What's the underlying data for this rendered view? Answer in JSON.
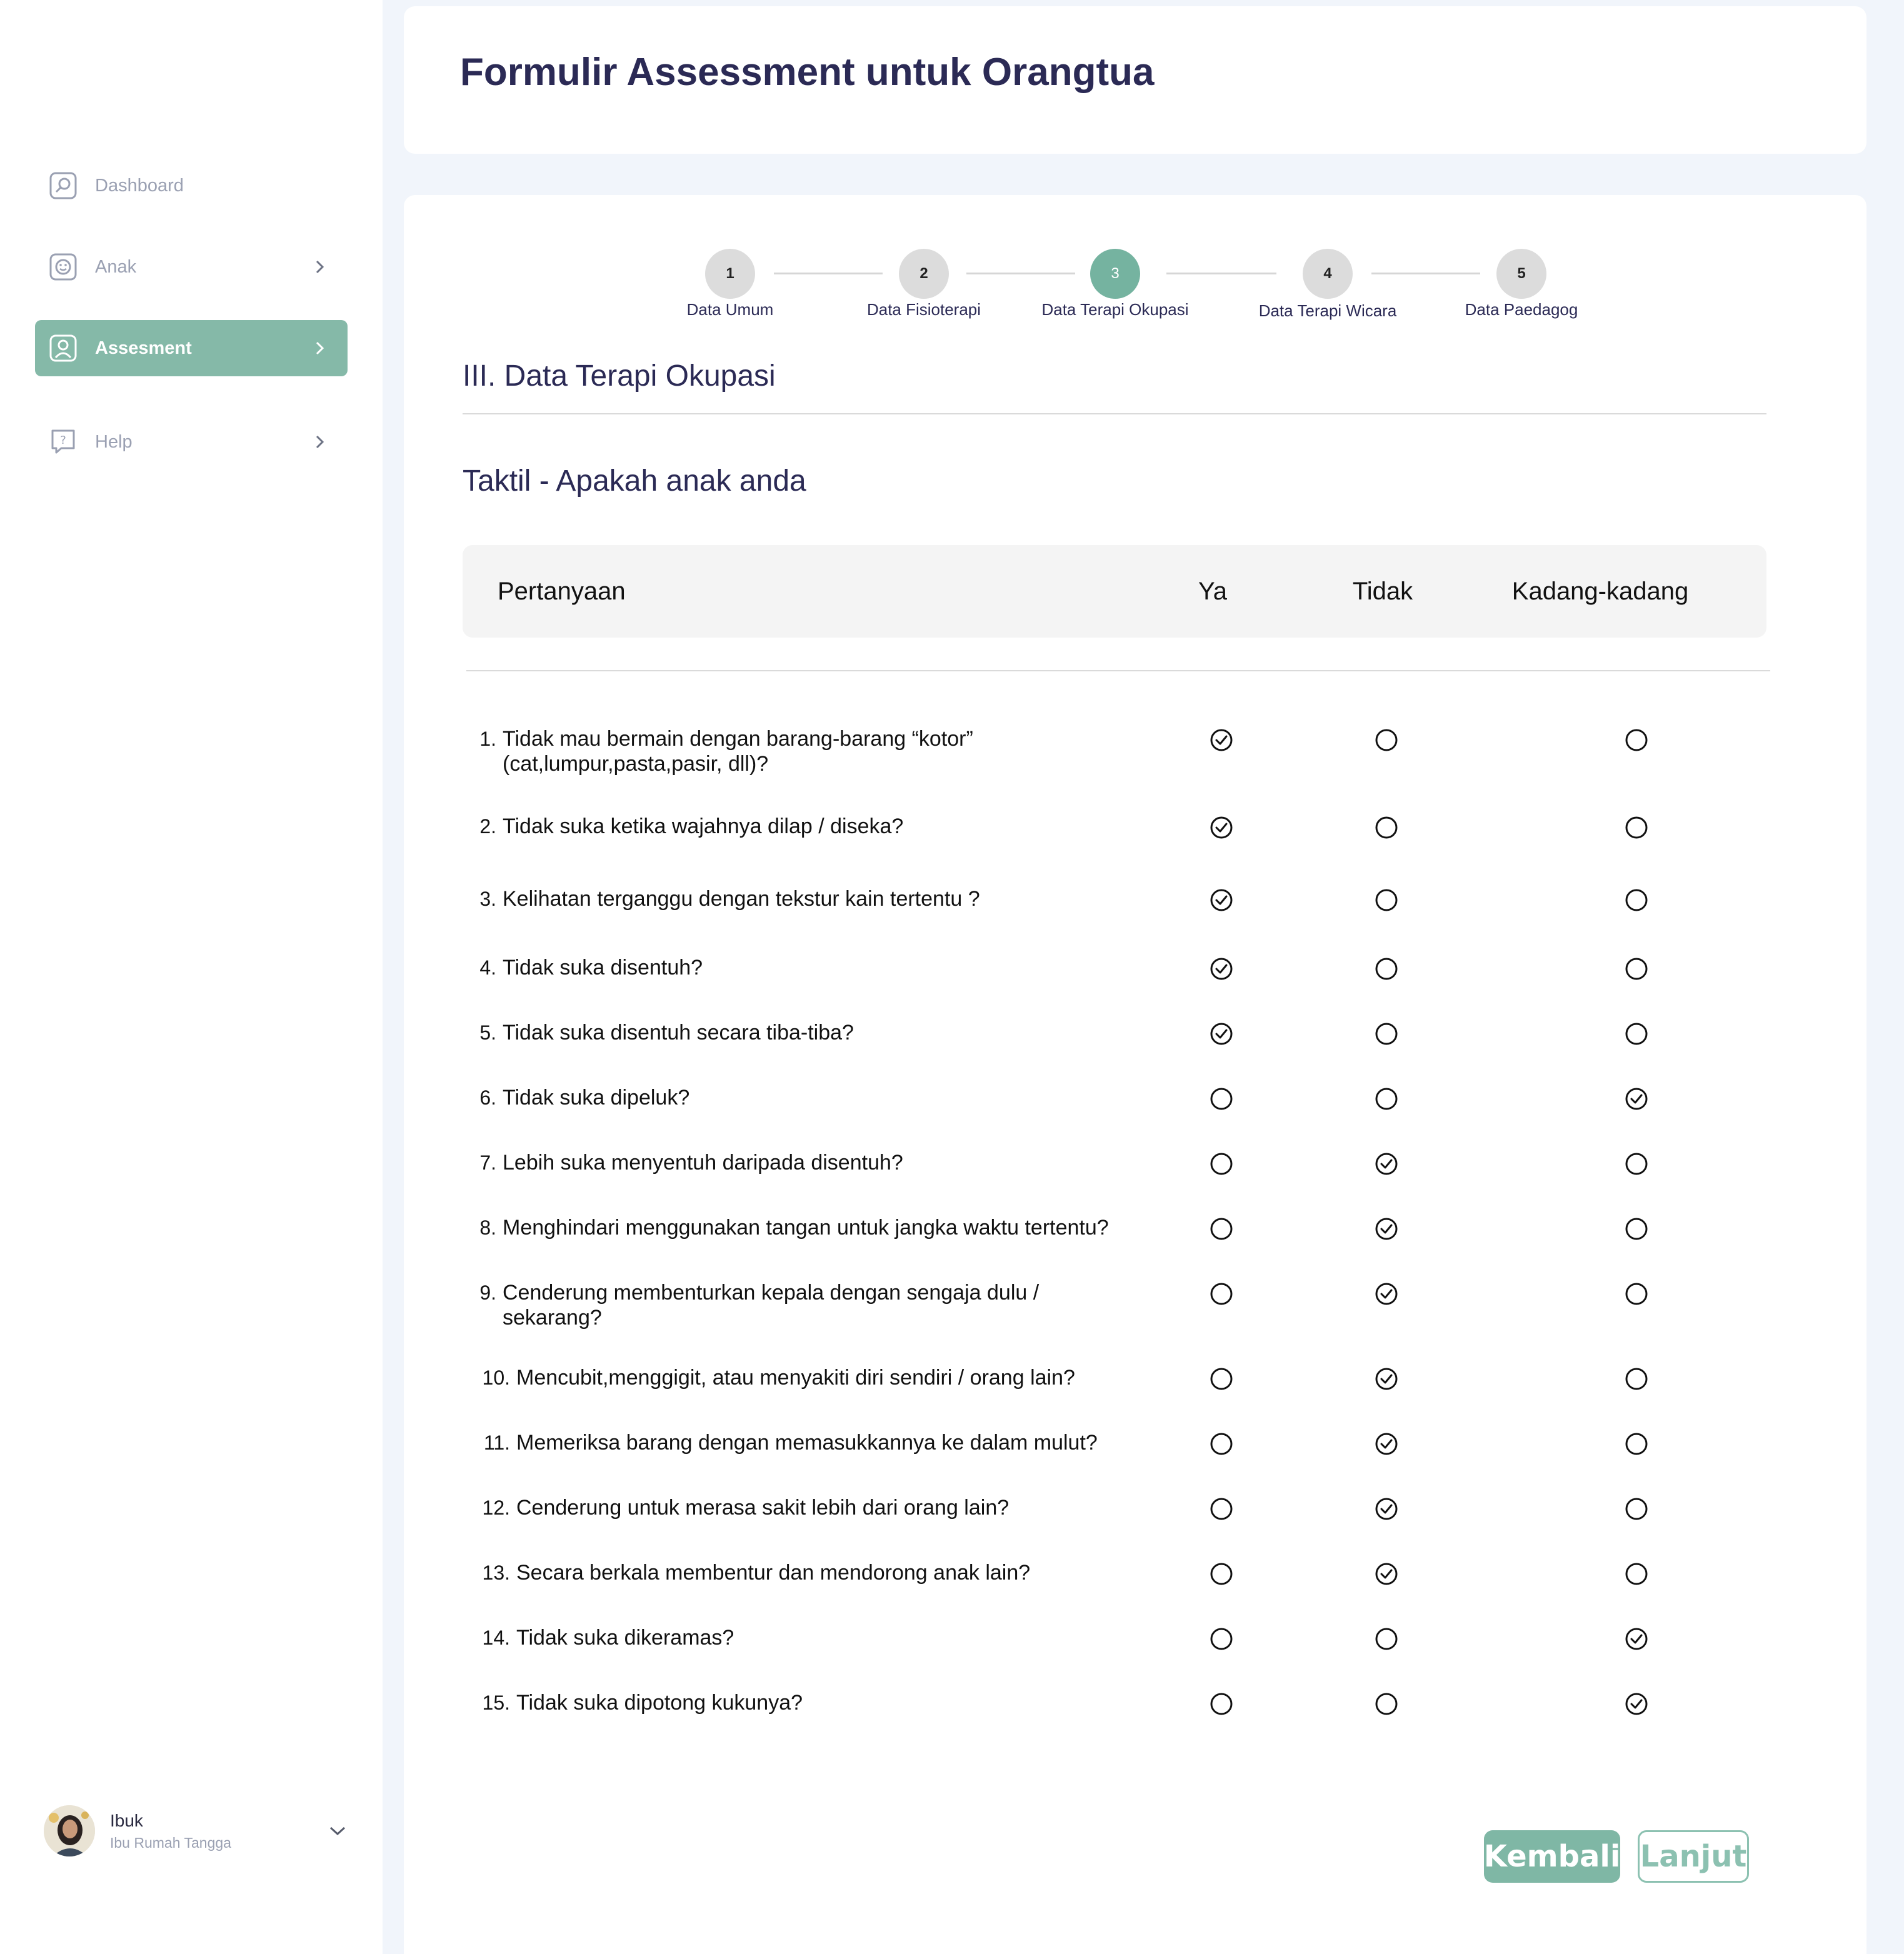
{
  "sidebar": {
    "items": [
      {
        "label": "Dashboard",
        "icon": "dashboard-icon"
      },
      {
        "label": "Anak",
        "icon": "face-icon"
      },
      {
        "label": "Assesment",
        "icon": "user-icon"
      },
      {
        "label": "Help",
        "icon": "help-icon"
      }
    ],
    "active_index": 2,
    "active_color": "#85b9a8"
  },
  "profile": {
    "name": "Ibuk",
    "role": "Ibu Rumah Tangga"
  },
  "header": {
    "title": "Formulir Assessment untuk Orangtua"
  },
  "stepper": {
    "steps": [
      {
        "number": "1",
        "label": "Data Umum"
      },
      {
        "number": "2",
        "label": "Data Fisioterapi"
      },
      {
        "number": "3",
        "label": "Data Terapi Okupasi"
      },
      {
        "number": "4",
        "label": "Data Terapi Wicara"
      },
      {
        "number": "5",
        "label": "Data Paedagog"
      }
    ],
    "active_step": 3,
    "active_color": "#75b3a0"
  },
  "section": {
    "title": "III. Data Terapi Okupasi",
    "subtitle": "Taktil - Apakah anak anda"
  },
  "table": {
    "headers": {
      "question": "Pertanyaan",
      "yes": "Ya",
      "no": "Tidak",
      "sometimes": "Kadang-kadang"
    },
    "rows": [
      {
        "num": "1.",
        "line1": "Tidak mau bermain dengan barang-barang “kotor”",
        "line2": "(cat,lumpur,pasta,pasir, dll)?",
        "answer": "yes"
      },
      {
        "num": "2.",
        "line1": "Tidak suka ketika wajahnya dilap / diseka?",
        "line2": "",
        "answer": "yes"
      },
      {
        "num": "3.",
        "line1": "Kelihatan terganggu dengan tekstur kain tertentu ?",
        "line2": "",
        "answer": "yes"
      },
      {
        "num": "4.",
        "line1": "Tidak suka disentuh?",
        "line2": "",
        "answer": "yes"
      },
      {
        "num": "5.",
        "line1": "Tidak suka disentuh secara tiba-tiba?",
        "line2": "",
        "answer": "yes"
      },
      {
        "num": "6.",
        "line1": "Tidak suka dipeluk?",
        "line2": "",
        "answer": "sometimes"
      },
      {
        "num": "7.",
        "line1": "Lebih suka menyentuh daripada disentuh?",
        "line2": "",
        "answer": "no"
      },
      {
        "num": "8.",
        "line1": "Menghindari menggunakan tangan untuk jangka waktu tertentu?",
        "line2": "",
        "answer": "no"
      },
      {
        "num": "9.",
        "line1": "Cenderung membenturkan kepala dengan sengaja dulu /",
        "line2": "sekarang?",
        "answer": "no"
      },
      {
        "num": "10.",
        "line1": "Mencubit,menggigit, atau menyakiti diri sendiri / orang lain?",
        "line2": "",
        "answer": "no"
      },
      {
        "num": "11.",
        "line1": "Memeriksa barang dengan memasukkannya ke dalam mulut?",
        "line2": "",
        "answer": "no"
      },
      {
        "num": "12.",
        "line1": "Cenderung untuk merasa sakit lebih dari orang lain?",
        "line2": "",
        "answer": "no"
      },
      {
        "num": "13.",
        "line1": "Secara berkala membentur dan mendorong anak lain?",
        "line2": "",
        "answer": "no"
      },
      {
        "num": "14.",
        "line1": "Tidak suka dikeramas?",
        "line2": "",
        "answer": "sometimes"
      },
      {
        "num": "15.",
        "line1": "Tidak suka dipotong kukunya?",
        "line2": "",
        "answer": "sometimes"
      }
    ]
  },
  "buttons": {
    "back": "Kembali",
    "next": "Lanjut"
  },
  "colors": {
    "primary": "#7fb7a5",
    "title": "#2b2a55",
    "background": "#f1f5fb"
  }
}
